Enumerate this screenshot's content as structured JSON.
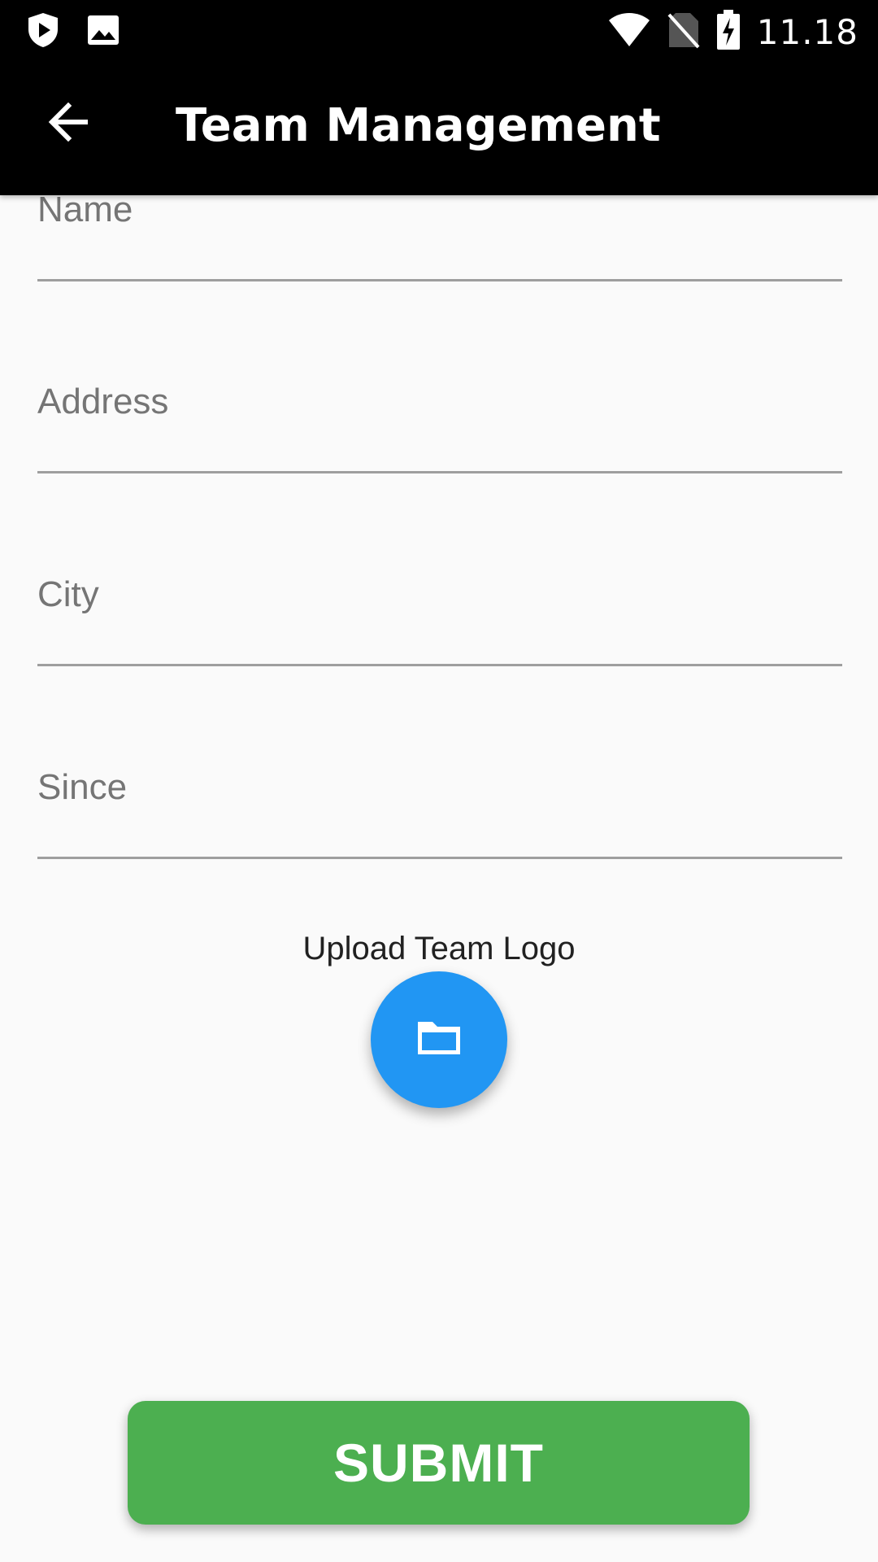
{
  "status_bar": {
    "time": "11.18",
    "icons": [
      "shield-play-icon",
      "image-icon",
      "wifi-icon",
      "no-sim-icon",
      "battery-charging-icon"
    ]
  },
  "app_bar": {
    "title": "Team Management",
    "back_icon": "arrow-back-icon"
  },
  "form": {
    "fields": [
      {
        "placeholder": "Name",
        "value": ""
      },
      {
        "placeholder": "Address",
        "value": ""
      },
      {
        "placeholder": "City",
        "value": ""
      },
      {
        "placeholder": "Since",
        "value": ""
      }
    ],
    "upload_label": "Upload Team Logo",
    "upload_icon": "folder-icon",
    "submit_label": "SUBMIT"
  },
  "colors": {
    "app_bar": "#000000",
    "fab": "#2196f3",
    "submit": "#4caf50",
    "background": "#fafafa"
  }
}
